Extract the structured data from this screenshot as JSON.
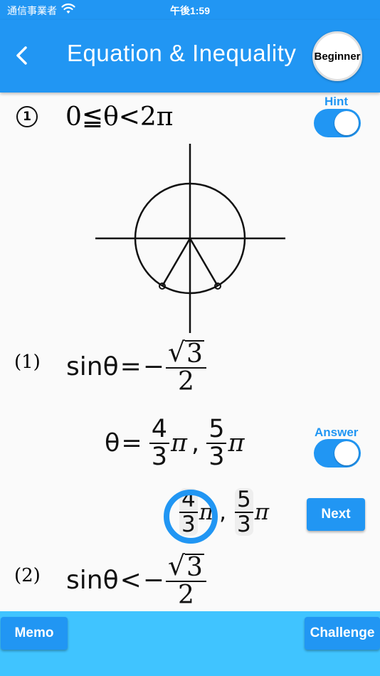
{
  "status": {
    "carrier": "通信事業者",
    "time": "午後1:59"
  },
  "header": {
    "title": "Equation & Inequality",
    "level": "Beginner"
  },
  "problem": {
    "number": "1",
    "condition": "0≦θ<2π",
    "hint_label": "Hint",
    "hint_on": true,
    "answer_label": "Answer",
    "answer_on": true
  },
  "sub1": {
    "label": "(1)",
    "lhs": "sinθ",
    "rel": "=",
    "minus": "−",
    "sqrt_arg": "3",
    "den": "2",
    "answer_var": "θ",
    "answer_rel": "=",
    "ans1_num": "4",
    "ans1_den": "3",
    "ans2_num": "5",
    "ans2_den": "3",
    "pi": "π",
    "comma": ","
  },
  "sub2": {
    "label": "(2)",
    "lhs": "sinθ",
    "rel": "<",
    "minus": "−",
    "sqrt_arg": "3",
    "den": "2"
  },
  "buttons": {
    "next": "Next",
    "memo": "Memo",
    "challenge": "Challenge"
  },
  "colors": {
    "primary": "#2196f3",
    "bottom_bar": "#40c4ff"
  }
}
